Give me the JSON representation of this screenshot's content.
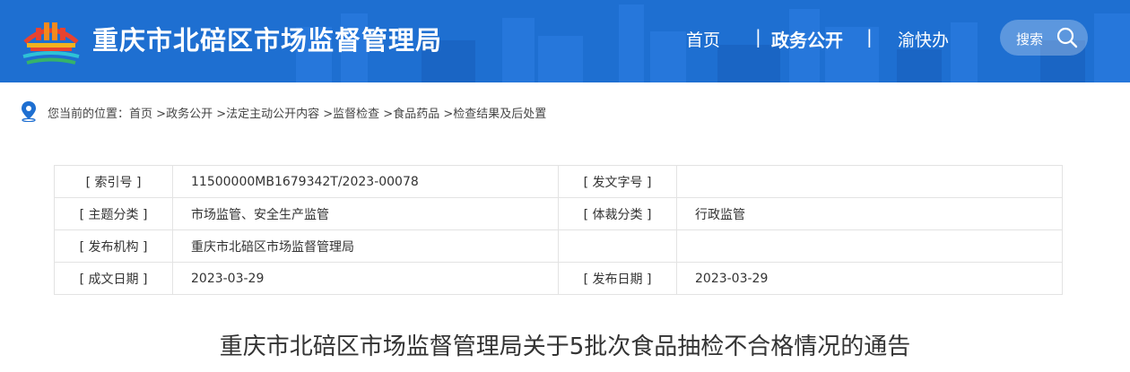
{
  "header": {
    "site_title": "重庆市北碚区市场监督管理局",
    "nav": {
      "home": "首页",
      "sep1": "|",
      "gov": "政务公开",
      "sep2": "|",
      "yu": "渝快办"
    },
    "search_label": "搜索",
    "colors": {
      "header_bg": "#1e6fd1",
      "title": "#ffffff"
    }
  },
  "breadcrumb": {
    "prefix": "您当前的位置：",
    "items": [
      "首页",
      "政务公开",
      "法定主动公开内容",
      "监督检查",
      "食品药品",
      "检查结果及后处置"
    ],
    "separator": " >"
  },
  "meta": {
    "rows": [
      {
        "k1": "[ 索引号 ]",
        "v1": "11500000MB1679342T/2023-00078",
        "k2": "[ 发文字号 ]",
        "v2": ""
      },
      {
        "k1": "[ 主题分类 ]",
        "v1": "市场监管、安全生产监管",
        "k2": "[ 体裁分类 ]",
        "v2": "行政监管"
      },
      {
        "k1": "[ 发布机构 ]",
        "v1": "重庆市北碚区市场监督管理局",
        "k2": "",
        "v2": ""
      },
      {
        "k1": "[ 成文日期 ]",
        "v1": "2023-03-29",
        "k2": "[ 发布日期 ]",
        "v2": "2023-03-29"
      }
    ]
  },
  "document": {
    "title": "重庆市北碚区市场监督管理局关于5批次食品抽检不合格情况的通告"
  },
  "icons": {
    "logo": "government-building-logo",
    "search": "search-icon",
    "location": "location-pin-icon"
  }
}
